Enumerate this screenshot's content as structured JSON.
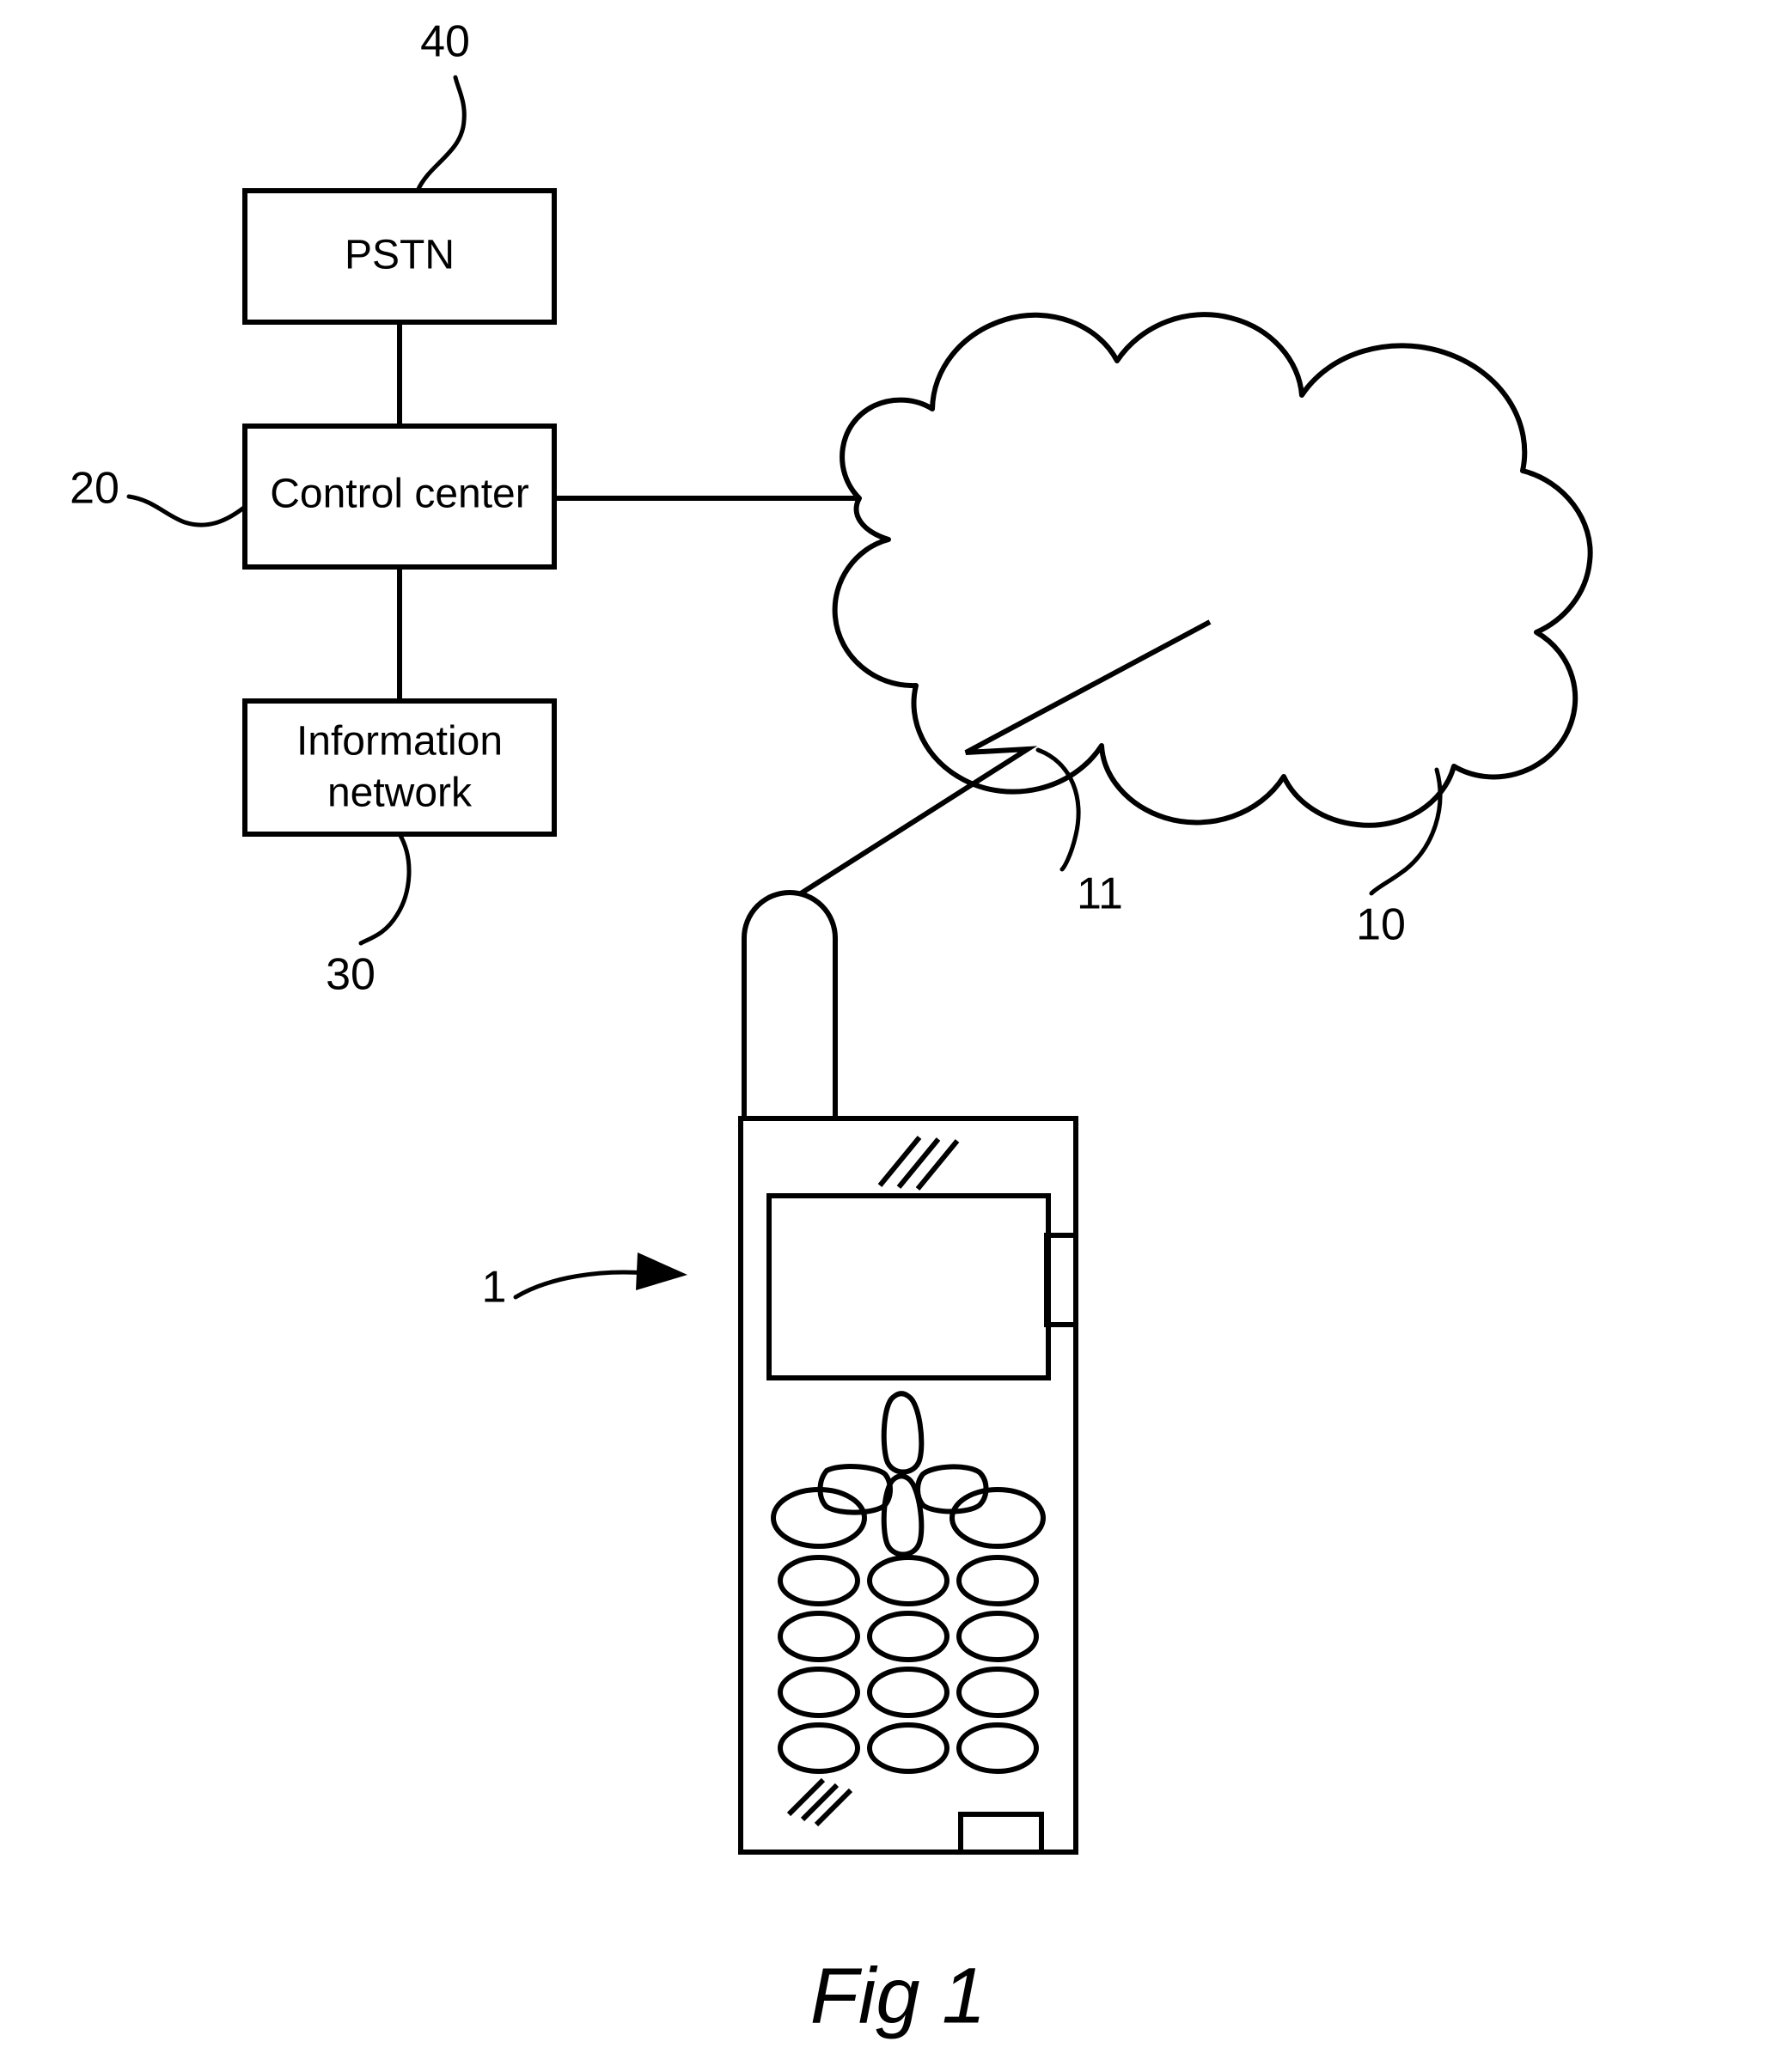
{
  "figure": {
    "caption": "Fig 1",
    "background_color": "#ffffff",
    "line_color": "#000000"
  },
  "blocks": [
    {
      "id": "pstn",
      "label": "PSTN",
      "ref": "40"
    },
    {
      "id": "control_center",
      "label": "Control center",
      "ref": "20"
    },
    {
      "id": "information_network",
      "label": "Information\nnetwork",
      "ref": "30"
    }
  ],
  "block_labels": {
    "pstn": "PSTN",
    "control_center": "Control center",
    "information_network_line1": "Information",
    "information_network_line2": "network"
  },
  "reference_numerals": {
    "pstn": "40",
    "control_center": "20",
    "information_network": "30",
    "cloud_network": "10",
    "radio_link": "11",
    "mobile_terminal": "1"
  },
  "elements": {
    "cloud": {
      "name": "radio network cloud",
      "ref": "10"
    },
    "radio_link": {
      "name": "radio link",
      "ref": "11"
    },
    "mobile_phone": {
      "name": "mobile terminal",
      "ref": "1",
      "parts": [
        "antenna",
        "earpiece-grille",
        "display-screen",
        "side-button",
        "navigation-keypad",
        "numeric-keypad",
        "microphone-grille",
        "bottom-connector"
      ]
    }
  },
  "keypad": {
    "nav_keys": [
      "up",
      "left",
      "right",
      "down"
    ],
    "key_rows": 5,
    "keys_per_row": 3,
    "total_keys": 15
  },
  "connections": [
    {
      "from": "pstn",
      "to": "control_center"
    },
    {
      "from": "control_center",
      "to": "information_network"
    },
    {
      "from": "control_center",
      "to": "cloud"
    },
    {
      "from": "cloud",
      "to": "mobile_phone",
      "label": "11"
    }
  ]
}
